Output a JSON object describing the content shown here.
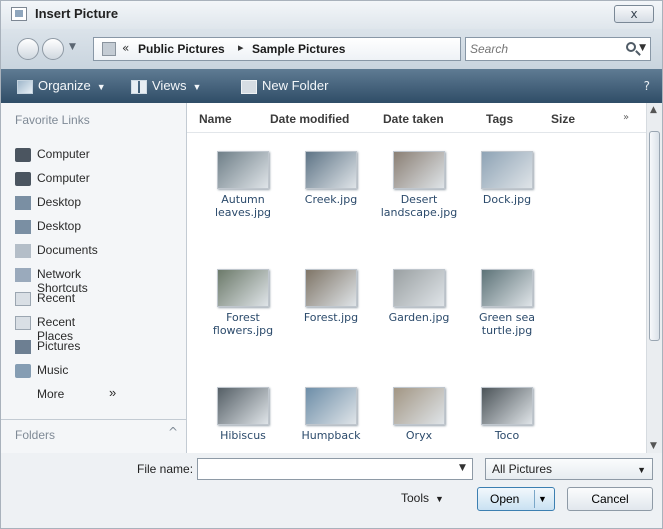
{
  "window": {
    "title": "Insert Picture",
    "close_label": "x"
  },
  "address": {
    "chevron": "«",
    "crumbs": [
      "Public Pictures",
      "Sample Pictures"
    ],
    "separator": "▸",
    "search_placeholder": "Search"
  },
  "toolbar": {
    "organize": "Organize",
    "views": "Views",
    "new_folder": "New Folder",
    "help": "?"
  },
  "nav": {
    "favorite_links_heading": "Favorite Links",
    "items": [
      {
        "label": "Computer",
        "icon": "computer-icon"
      },
      {
        "label": "Computer",
        "icon": "computer-icon"
      },
      {
        "label": "Desktop",
        "icon": "desktop-icon"
      },
      {
        "label": "Desktop",
        "icon": "desktop-icon"
      },
      {
        "label": "Documents",
        "icon": "documents-icon"
      },
      {
        "label": "Network Shortcuts",
        "icon": "network-icon"
      },
      {
        "label": "Recent",
        "icon": "recent-icon"
      },
      {
        "label": "Recent Places",
        "icon": "recent-icon"
      },
      {
        "label": "Pictures",
        "icon": "pictures-icon"
      },
      {
        "label": "Music",
        "icon": "music-icon"
      }
    ],
    "more_label": "More",
    "more_chevron": "»",
    "folders_label": "Folders",
    "folders_chevron": "^"
  },
  "columns": [
    "Name",
    "Date modified",
    "Date taken",
    "Tags",
    "Size"
  ],
  "columns_more": "»",
  "files": [
    {
      "name": "Autumn leaves.jpg",
      "thumb_color": "#6f7f88"
    },
    {
      "name": "Creek.jpg",
      "thumb_color": "#5e7486"
    },
    {
      "name": "Desert landscape.jpg",
      "thumb_color": "#8a7f74"
    },
    {
      "name": "Dock.jpg",
      "thumb_color": "#8ea3b5"
    },
    {
      "name": "Forest flowers.jpg",
      "thumb_color": "#6c7a6a"
    },
    {
      "name": "Forest.jpg",
      "thumb_color": "#7f7567"
    },
    {
      "name": "Garden.jpg",
      "thumb_color": "#9aa0a2"
    },
    {
      "name": "Green sea turtle.jpg",
      "thumb_color": "#5d7378"
    },
    {
      "name": "Hibiscus",
      "thumb_color": "#555f66"
    },
    {
      "name": "Humpback",
      "thumb_color": "#6d8ea8"
    },
    {
      "name": "Oryx",
      "thumb_color": "#a29684"
    },
    {
      "name": "Toco",
      "thumb_color": "#4c5459"
    }
  ],
  "footer": {
    "file_name_label": "File name:",
    "file_name_value": "",
    "filter_value": "All Pictures",
    "tools_label": "Tools",
    "open_label": "Open",
    "cancel_label": "Cancel"
  }
}
